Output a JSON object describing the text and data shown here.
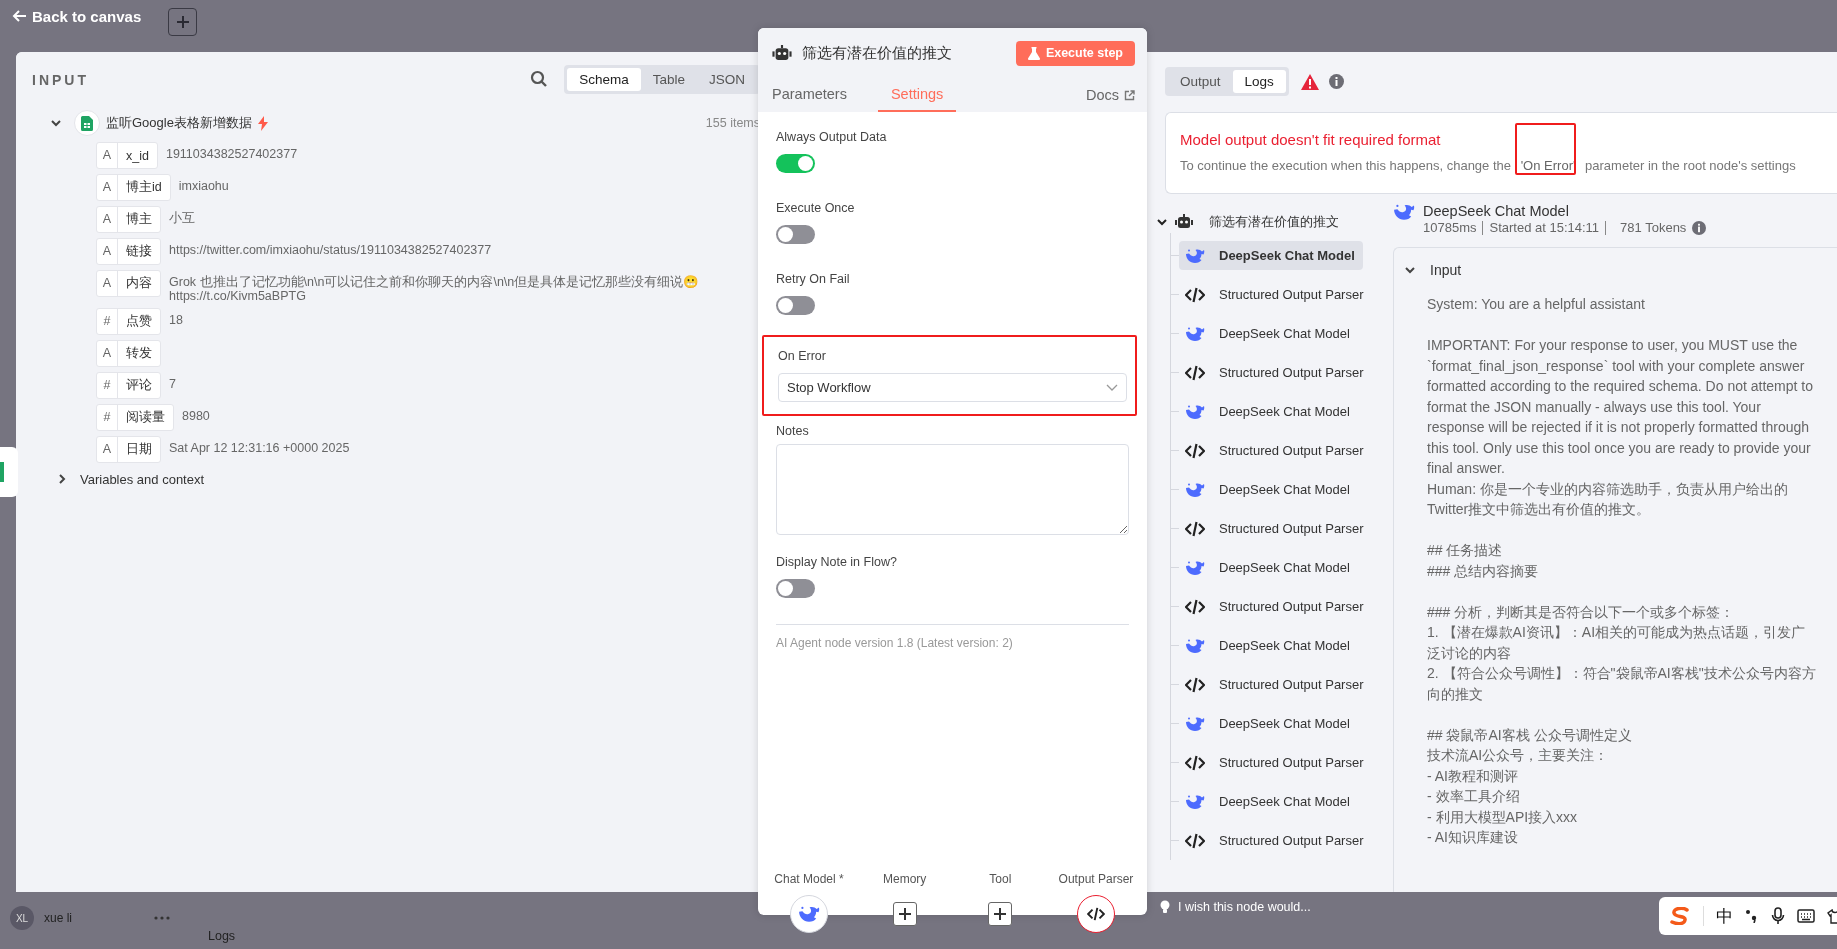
{
  "top_bar": {
    "back_label": "Back to canvas"
  },
  "input_panel": {
    "title": "INPUT",
    "view_tabs": [
      {
        "label": "Schema",
        "selected": true
      },
      {
        "label": "Table",
        "selected": false
      },
      {
        "label": "JSON",
        "selected": false
      }
    ],
    "node": {
      "name": "监听Google表格新增数据",
      "count": "155 items",
      "expanded": true,
      "fields": [
        {
          "type": "A",
          "key": "x_id",
          "value": "1911034382527402377"
        },
        {
          "type": "A",
          "key": "博主id",
          "value": "imxiaohu"
        },
        {
          "type": "A",
          "key": "博主",
          "value": "小互"
        },
        {
          "type": "A",
          "key": "链接",
          "value": "https://twitter.com/imxiaohu/status/1911034382527402377"
        },
        {
          "type": "A",
          "key": "内容",
          "value": "Grok 也推出了记忆功能\\n\\n可以记住之前和你聊天的内容\\n\\n但是具体是记忆那些没有细说😬 https://t.co/Kivm5aBPTG"
        },
        {
          "type": "#",
          "key": "点赞",
          "value": "18"
        },
        {
          "type": "A",
          "key": "转发"
        },
        {
          "type": "#",
          "key": "评论",
          "value": "7"
        },
        {
          "type": "#",
          "key": "阅读量",
          "value": "8980"
        },
        {
          "type": "A",
          "key": "日期",
          "value": "Sat Apr 12 12:31:16 +0000 2025"
        }
      ]
    },
    "variables": {
      "label": "Variables and context",
      "expanded": false
    }
  },
  "node_panel": {
    "title": "筛选有潜在价值的推文",
    "execute_label": "Execute step",
    "tabs": [
      {
        "label": "Parameters",
        "selected": false
      },
      {
        "label": "Settings",
        "selected": true
      }
    ],
    "docs_label": "Docs",
    "settings": [
      {
        "kind": "toggle",
        "label": "Always Output Data",
        "on": true
      },
      {
        "kind": "toggle",
        "label": "Execute Once",
        "on": false
      },
      {
        "kind": "toggle",
        "label": "Retry On Fail",
        "on": false
      },
      {
        "kind": "select",
        "label": "On Error",
        "value": "Stop Workflow",
        "highlighted": true
      },
      {
        "kind": "textarea",
        "label": "Notes"
      },
      {
        "kind": "toggle",
        "label": "Display Note in Flow?",
        "on": false
      }
    ],
    "version_note": "AI Agent node version 1.8 (Latest version: 2)",
    "connectors": [
      {
        "label": "Chat Model *",
        "kind": "model",
        "error": false
      },
      {
        "label": "Memory",
        "kind": "add",
        "error": false
      },
      {
        "label": "Tool",
        "kind": "add",
        "error": false
      },
      {
        "label": "Output Parser",
        "kind": "parser",
        "error": true
      }
    ]
  },
  "logs_panel": {
    "view_tabs": [
      {
        "label": "Output",
        "selected": false
      },
      {
        "label": "Logs",
        "selected": true
      }
    ],
    "error": {
      "title": "Model output doesn't fit required format",
      "description_parts": [
        {
          "text": "To continue the execution when this happens, change the ",
          "highlighted": false
        },
        {
          "text": "'On Error'",
          "highlighted": true
        },
        {
          "text": " parameter in the root node's settings",
          "highlighted": false
        }
      ]
    },
    "tree": {
      "label": "筛选有潜在价值的推文",
      "expanded": true,
      "children": [
        {
          "label": "DeepSeek Chat Model",
          "kind": "model",
          "selected": true
        },
        {
          "label": "Structured Output Parser",
          "kind": "parser",
          "selected": false
        },
        {
          "label": "DeepSeek Chat Model",
          "kind": "model",
          "selected": false
        },
        {
          "label": "Structured Output Parser",
          "kind": "parser",
          "selected": false
        },
        {
          "label": "DeepSeek Chat Model",
          "kind": "model",
          "selected": false
        },
        {
          "label": "Structured Output Parser",
          "kind": "parser",
          "selected": false
        },
        {
          "label": "DeepSeek Chat Model",
          "kind": "model",
          "selected": false
        },
        {
          "label": "Structured Output Parser",
          "kind": "parser",
          "selected": false
        },
        {
          "label": "DeepSeek Chat Model",
          "kind": "model",
          "selected": false
        },
        {
          "label": "Structured Output Parser",
          "kind": "parser",
          "selected": false
        },
        {
          "label": "DeepSeek Chat Model",
          "kind": "model",
          "selected": false
        },
        {
          "label": "Structured Output Parser",
          "kind": "parser",
          "selected": false
        },
        {
          "label": "DeepSeek Chat Model",
          "kind": "model",
          "selected": false
        },
        {
          "label": "Structured Output Parser",
          "kind": "parser",
          "selected": false
        },
        {
          "label": "DeepSeek Chat Model",
          "kind": "model",
          "selected": false
        },
        {
          "label": "Structured Output Parser",
          "kind": "parser",
          "selected": false
        }
      ]
    },
    "detail": {
      "title": "DeepSeek Chat Model",
      "duration": "10785ms",
      "started": "Started at 15:14:11",
      "tokens": "781 Tokens",
      "section": {
        "label": "Input",
        "expanded": true,
        "paragraphs": [
          [
            "System: You are a helpful assistant"
          ],
          [
            "IMPORTANT: For your response to user, you MUST use the `format_final_json_response` tool with your complete answer formatted according to the required schema. Do not attempt to format the JSON manually - always use this tool. Your response will be rejected if it is not properly formatted through this tool. Only use this tool once you are ready to provide your final answer.",
            "Human: 你是一个专业的内容筛选助手，负责从用户给出的Twitter推文中筛选出有价值的推文。"
          ],
          [
            "## 任务描述",
            "### 总结内容摘要"
          ],
          [
            "### 分析，判断其是否符合以下一个或多个标签：",
            "1. 【潜在爆款AI资讯】：AI相关的可能成为热点话题，引发广泛讨论的内容",
            "2. 【符合公众号调性】：符合\"袋鼠帝AI客栈\"技术公众号内容方向的推文"
          ],
          [
            "## 袋鼠帝AI客栈 公众号调性定义",
            "技术流AI公众号，主要关注：",
            "- AI教程和测评",
            "- 效率工具介绍",
            "- 利用大模型API接入xxx",
            "- AI知识库建设"
          ]
        ]
      }
    }
  },
  "bottom_bar": {
    "user": {
      "initials": "XL",
      "name": "xue li"
    },
    "logs_label": "Logs",
    "feedback": "I wish this node would...",
    "ime_mode": "中"
  }
}
